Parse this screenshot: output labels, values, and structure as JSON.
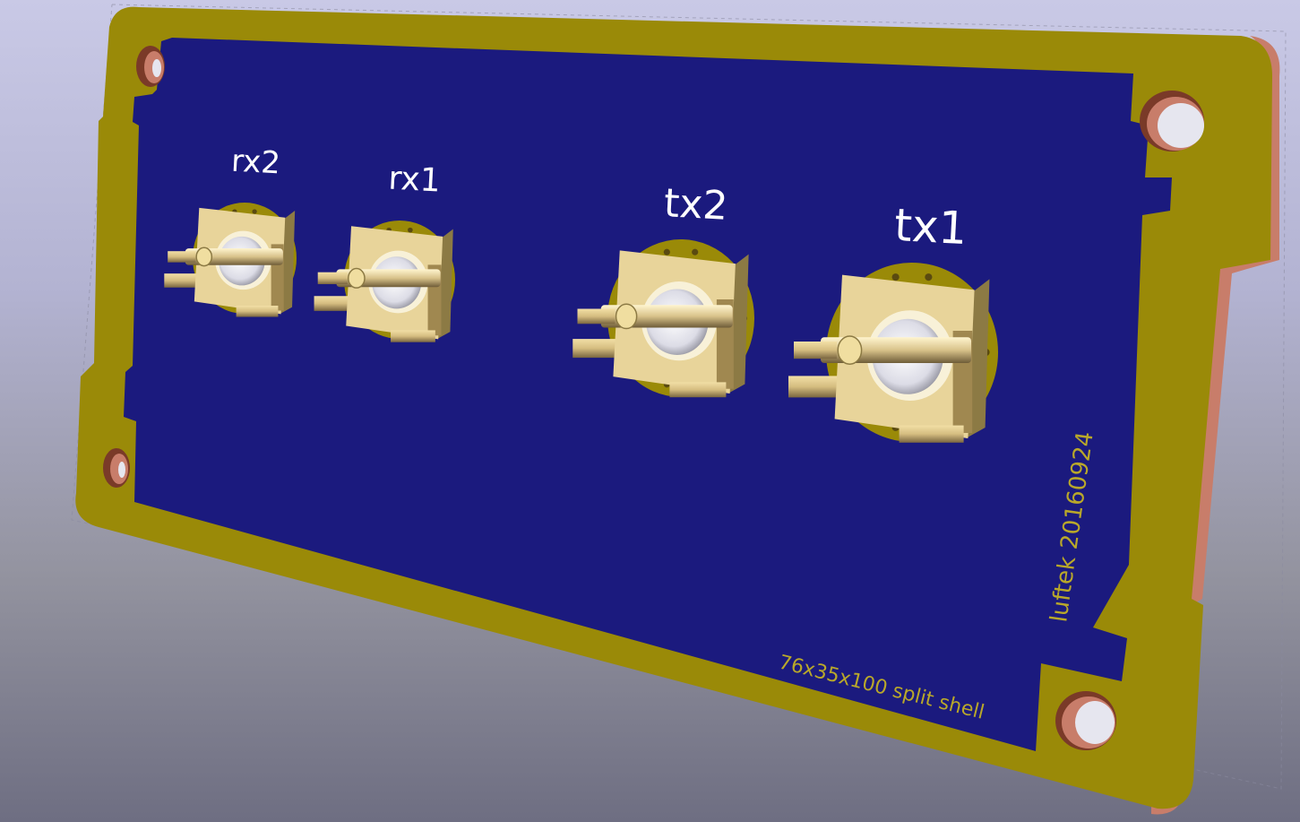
{
  "board": {
    "labels": {
      "rx2": "rx2",
      "rx1": "rx1",
      "tx2": "tx2",
      "tx1": "tx1"
    },
    "silkscreen_date": "luftek 20160924",
    "silkscreen_size": "76x35x100 split shell"
  },
  "colors": {
    "background_top": "#c9c9e6",
    "background_bottom": "#6e6e82",
    "board_edge": "#c87d6a",
    "copper_border": "#9a8a08",
    "soldermask": "#1b1a7e",
    "connector_body": "#e8d49a",
    "pin_gold": "#c0a060",
    "hole_inner": "#e6e6ef",
    "silkscreen": "#ffffff",
    "silkscreen_small": "#b9a82a"
  }
}
